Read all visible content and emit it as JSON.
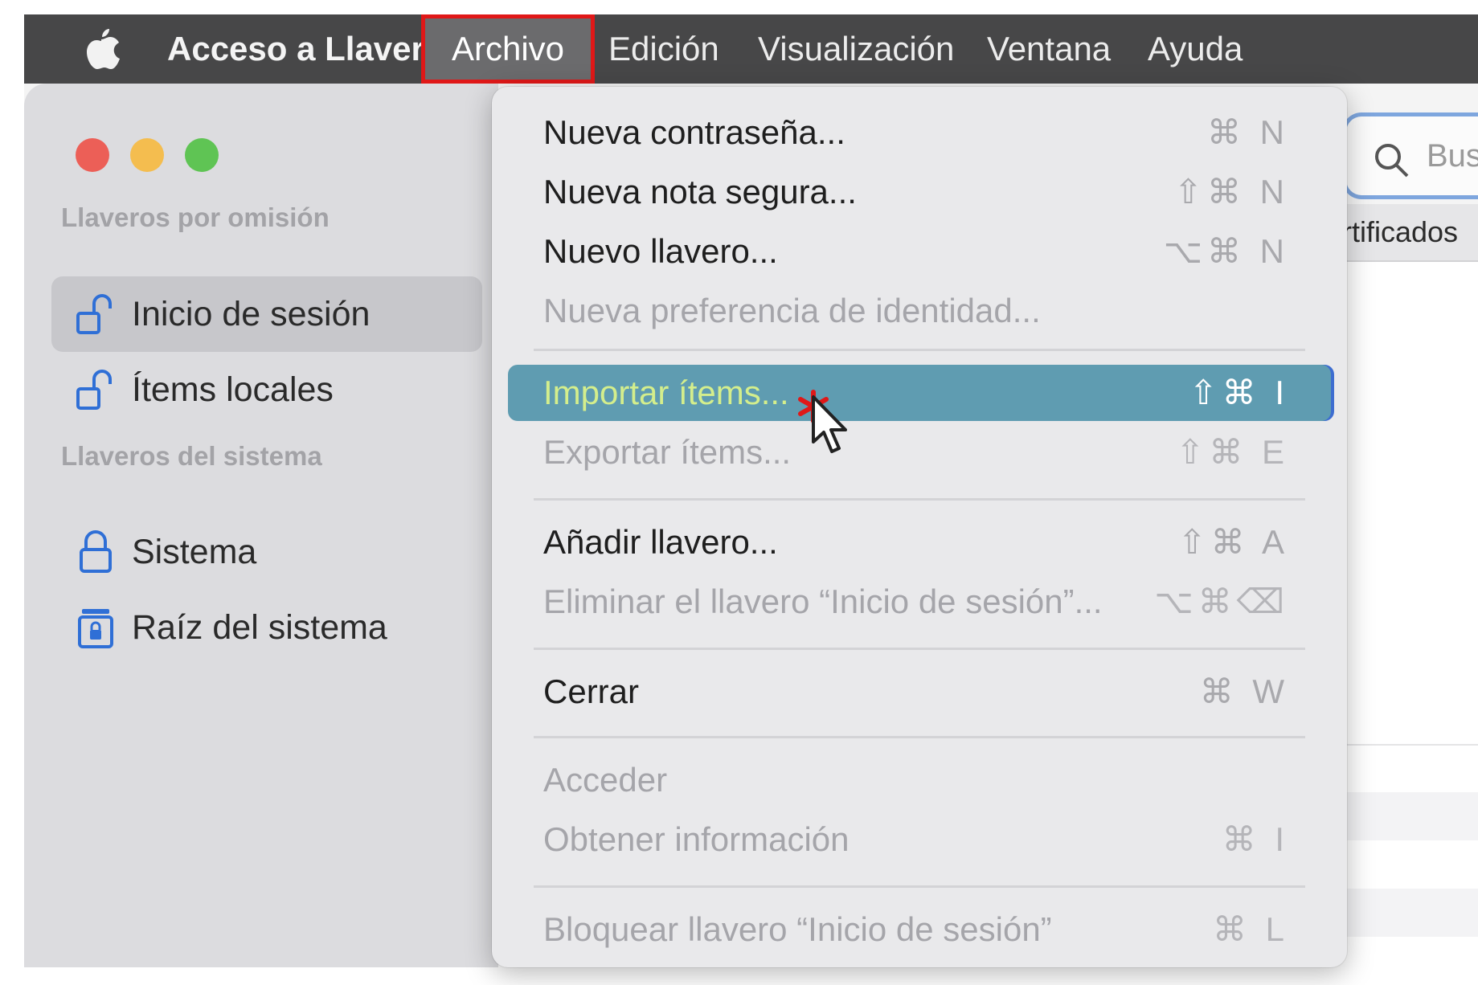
{
  "menubar": {
    "app_name": "Acceso a Llaveros",
    "items": [
      "Archivo",
      "Edición",
      "Visualización",
      "Ventana",
      "Ayuda"
    ],
    "active_item": "Archivo"
  },
  "sidebar": {
    "section_default": "Llaveros por omisión",
    "default_items": [
      {
        "label": "Inicio de sesión",
        "icon": "unlocked-padlock-icon",
        "selected": true
      },
      {
        "label": "Ítems locales",
        "icon": "unlocked-padlock-icon",
        "selected": false
      }
    ],
    "section_system": "Llaveros del sistema",
    "system_items": [
      {
        "label": "Sistema",
        "icon": "locked-padlock-icon"
      },
      {
        "label": "Raíz del sistema",
        "icon": "system-root-lock-icon"
      }
    ]
  },
  "search": {
    "placeholder_partial": "Bus"
  },
  "tabs": {
    "visible_partial": "rtificados"
  },
  "file_menu": {
    "items": [
      {
        "label": "Nueva contraseña...",
        "shortcut": "⌘ N",
        "enabled": true
      },
      {
        "label": "Nueva nota segura...",
        "shortcut": "⇧⌘ N",
        "enabled": true
      },
      {
        "label": "Nuevo llavero...",
        "shortcut": "⌥⌘ N",
        "enabled": true
      },
      {
        "label": "Nueva preferencia de identidad...",
        "shortcut": "",
        "enabled": false
      },
      {
        "label": "Importar ítems...",
        "shortcut": "⇧⌘ I",
        "enabled": true,
        "highlighted": true
      },
      {
        "label": "Exportar ítems...",
        "shortcut": "⇧⌘ E",
        "enabled": false
      },
      {
        "label": "Añadir llavero...",
        "shortcut": "⇧⌘ A",
        "enabled": true
      },
      {
        "label": "Eliminar el llavero “Inicio de sesión”...",
        "shortcut": "⌥⌘⌫",
        "enabled": false
      },
      {
        "label": "Cerrar",
        "shortcut": "⌘ W",
        "enabled": true
      },
      {
        "label": "Acceder",
        "shortcut": "",
        "enabled": false
      },
      {
        "label": "Obtener información",
        "shortcut": "⌘ I",
        "enabled": false
      },
      {
        "label": "Bloquear llavero “Inicio de sesión”",
        "shortcut": "⌘ L",
        "enabled": false
      }
    ]
  },
  "colors": {
    "menubar_bg": "#474748",
    "highlight_bg": "#5f9cb1",
    "highlight_text": "#d4ee8c",
    "annotation_red": "#e01818"
  }
}
